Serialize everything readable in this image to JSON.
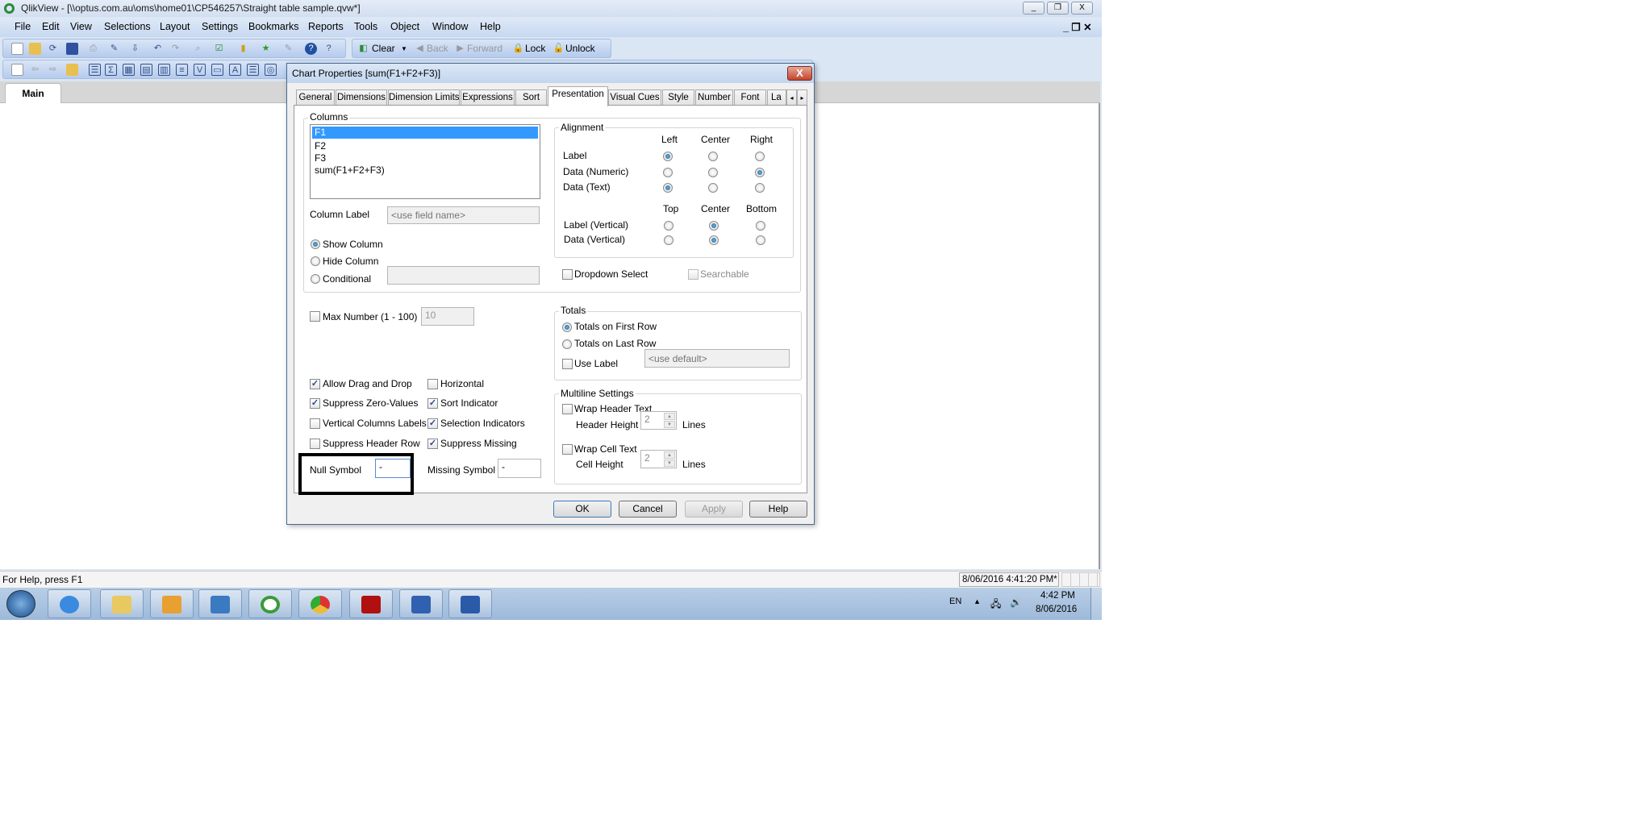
{
  "window": {
    "title": "QlikView - [\\\\optus.com.au\\oms\\home01\\CP546257\\Straight table sample.qvw*]",
    "controls": {
      "minimize": "_",
      "restore": "❐",
      "close": "X"
    }
  },
  "menu": [
    "File",
    "Edit",
    "View",
    "Selections",
    "Layout",
    "Settings",
    "Bookmarks",
    "Reports",
    "Tools",
    "Object",
    "Window",
    "Help"
  ],
  "toolbar": {
    "clear": "Clear",
    "back": "Back",
    "forward": "Forward",
    "lock": "Lock",
    "unlock": "Unlock"
  },
  "sheet_tab": "Main",
  "status": {
    "help": "For Help, press F1",
    "timestamp": "8/06/2016 4:41:20 PM*"
  },
  "taskbar": {
    "language": "EN",
    "time": "4:42 PM",
    "date": "8/06/2016",
    "apps": [
      "internet-explorer",
      "file-explorer",
      "outlook",
      "lync",
      "qlikview",
      "chrome",
      "acrobat",
      "remote-desktop",
      "word"
    ]
  },
  "dialog": {
    "title": "Chart Properties [sum(F1+F2+F3)]",
    "close": "X",
    "tabs": [
      "General",
      "Dimensions",
      "Dimension Limits",
      "Expressions",
      "Sort",
      "Presentation",
      "Visual Cues",
      "Style",
      "Number",
      "Font",
      "La"
    ],
    "active_tab": "Presentation",
    "columns": {
      "label": "Columns",
      "items": [
        "F1",
        "F2",
        "F3",
        "sum(F1+F2+F3)"
      ],
      "selected": "F1",
      "column_label": "Column Label",
      "column_label_placeholder": "<use field name>",
      "show": "Show Column",
      "hide": "Hide Column",
      "conditional": "Conditional",
      "visibility": "Show Column"
    },
    "alignment": {
      "label": "Alignment",
      "h_headers": [
        "Left",
        "Center",
        "Right"
      ],
      "rows": [
        {
          "label": "Label",
          "value": "Left"
        },
        {
          "label": "Data (Numeric)",
          "value": "Right"
        },
        {
          "label": "Data (Text)",
          "value": "Left"
        }
      ],
      "v_headers": [
        "Top",
        "Center",
        "Bottom"
      ],
      "vrows": [
        {
          "label": "Label (Vertical)",
          "value": "Center"
        },
        {
          "label": "Data (Vertical)",
          "value": "Center"
        }
      ]
    },
    "dropdown_select": {
      "label": "Dropdown Select",
      "checked": false
    },
    "searchable": {
      "label": "Searchable",
      "checked": false
    },
    "max_number": {
      "label": "Max Number (1 - 100)",
      "checked": false,
      "value": "10"
    },
    "options": [
      {
        "label": "Allow Drag and Drop",
        "checked": true
      },
      {
        "label": "Horizontal",
        "checked": false
      },
      {
        "label": "Suppress Zero-Values",
        "checked": true
      },
      {
        "label": "Sort Indicator",
        "checked": true
      },
      {
        "label": "Vertical Columns Labels",
        "checked": false
      },
      {
        "label": "Selection Indicators",
        "checked": true
      },
      {
        "label": "Suppress Header Row",
        "checked": false
      },
      {
        "label": "Suppress Missing",
        "checked": true
      }
    ],
    "null_symbol": {
      "label": "Null Symbol",
      "value": "-"
    },
    "missing_symbol": {
      "label": "Missing Symbol",
      "value": "-"
    },
    "totals": {
      "label": "Totals",
      "first": "Totals on First Row",
      "last": "Totals on Last Row",
      "selected": "Totals on First Row",
      "use_label": "Use Label",
      "use_label_placeholder": "<use default>"
    },
    "multiline": {
      "label": "Multiline Settings",
      "wrap_header": "Wrap Header Text",
      "header_height": "Header Height",
      "header_value": "2",
      "wrap_cell": "Wrap Cell Text",
      "cell_height": "Cell Height",
      "cell_value": "2",
      "lines": "Lines"
    },
    "buttons": {
      "ok": "OK",
      "cancel": "Cancel",
      "apply": "Apply",
      "help": "Help"
    }
  }
}
